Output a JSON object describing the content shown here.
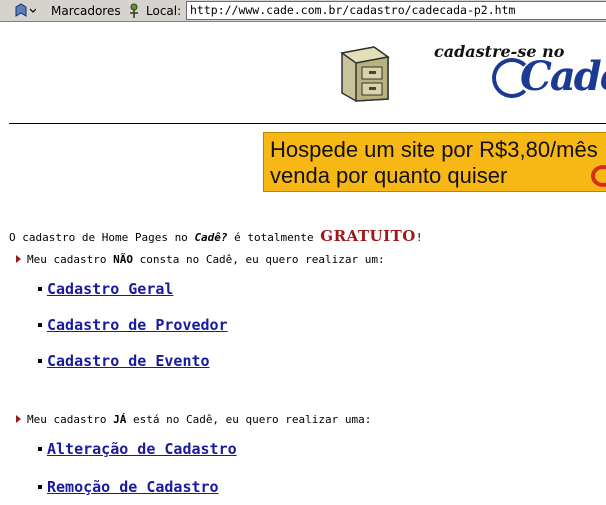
{
  "toolbar": {
    "bookmarks_label": "Marcadores",
    "location_label": "Local:",
    "url": "http://www.cade.com.br/cadastro/cadecada-p2.htm"
  },
  "header": {
    "cadastre_text": "cadastre-se no",
    "logo_text": "Cadê"
  },
  "banner": {
    "line1": "Hospede um site por R$3,80/mês",
    "line2": "venda por quanto quiser"
  },
  "intro": {
    "prefix": "O cadastro de Home Pages no ",
    "brand": "Cadê?",
    "middle": " é totalmente ",
    "highlight": "GRATUITO",
    "suffix": "!"
  },
  "section1": {
    "prefix": "Meu cadastro ",
    "emphasis": "NÃO",
    "suffix": " consta no Cadê, eu quero realizar um:",
    "links": [
      "Cadastro Geral",
      "Cadastro de Provedor",
      "Cadastro de Evento"
    ]
  },
  "section2": {
    "prefix": "Meu cadastro ",
    "emphasis": "JÁ",
    "suffix": " está no Cadê, eu quero realizar uma:",
    "links": [
      "Alteração de Cadastro",
      "Remoção de Cadastro"
    ]
  },
  "colors": {
    "link": "#1a1a9e",
    "accent": "#a01818",
    "banner": "#f7b715",
    "logo": "#1a3a93"
  }
}
